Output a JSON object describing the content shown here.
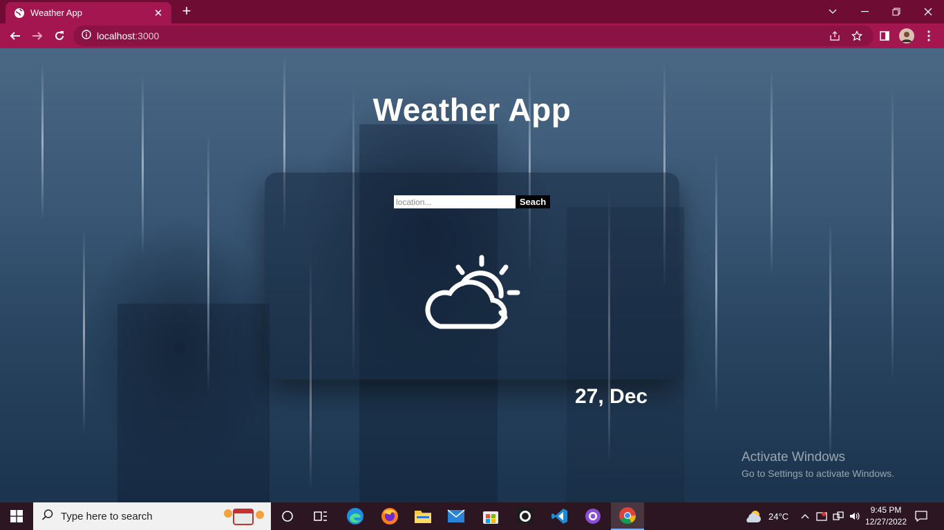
{
  "browser": {
    "tab_title": "Weather App",
    "tab_close": "✕",
    "new_tab": "+",
    "url_host": "localhost",
    "url_port": ":3000"
  },
  "app": {
    "title": "Weather App",
    "search": {
      "placeholder": "location...",
      "button_label": "Seach"
    },
    "weather_icon": "partly-cloudy-icon",
    "date": "27, Dec"
  },
  "watermark": {
    "line1": "Activate Windows",
    "line2": "Go to Settings to activate Windows."
  },
  "taskbar": {
    "search_placeholder": "Type here to search",
    "weather_temp": "24°C",
    "time": "9:45 PM",
    "date": "12/27/2022",
    "apps": [
      "task-view",
      "edge",
      "firefox",
      "file-explorer",
      "mail",
      "store",
      "github-desktop",
      "vscode",
      "github-app",
      "chrome"
    ]
  },
  "colors": {
    "titlebar": "#6e0c33",
    "toolbar": "#a3164f",
    "taskbar": "#2b1622",
    "search_button": "#000000"
  }
}
